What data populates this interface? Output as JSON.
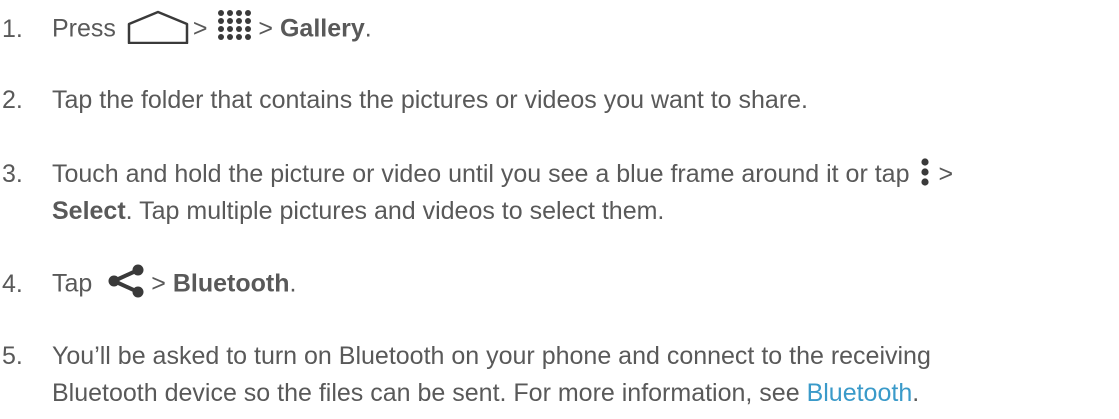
{
  "steps": [
    {
      "num": "1.",
      "t1": "Press",
      "sep1": ">",
      "sep2": ">",
      "bold": "Gallery",
      "end": "."
    },
    {
      "num": "2.",
      "text": "Tap the folder that contains the pictures or videos you want to share."
    },
    {
      "num": "3.",
      "line1": "Touch and hold the picture or video until you see a blue frame around it or tap",
      "sep": ">",
      "bold": "Select",
      "line2": ". Tap multiple pictures and videos to select them."
    },
    {
      "num": "4.",
      "t1": "Tap",
      "sep": ">",
      "bold": "Bluetooth",
      "end": "."
    },
    {
      "num": "5.",
      "line1": "You’ll be asked to turn on Bluetooth on your phone and connect to the receiving",
      "line2": "Bluetooth device so the files can be sent. For more information, see",
      "link": "Bluetooth",
      "end": "."
    }
  ],
  "icons": {
    "home": "home-icon",
    "apps": "apps-grid-icon",
    "menu": "menu-more-icon",
    "share": "share-icon"
  },
  "colors": {
    "text": "#595959",
    "link": "#3a9ac9"
  }
}
